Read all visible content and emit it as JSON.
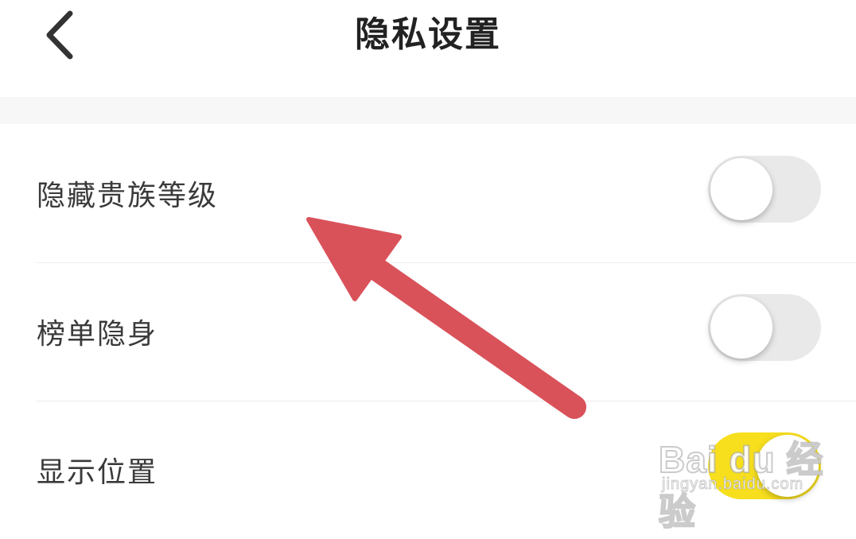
{
  "header": {
    "title": "隐私设置",
    "back_icon": "chevron-left-icon"
  },
  "settings": [
    {
      "label": "隐藏贵族等级",
      "enabled": false
    },
    {
      "label": "榜单隐身",
      "enabled": false
    },
    {
      "label": "显示位置",
      "enabled": true
    }
  ],
  "annotation": {
    "icon": "arrow-icon",
    "color": "#d9525a"
  },
  "watermark": {
    "logo": "Bai du 经验",
    "url": "jingyan.baidu.com"
  },
  "colors": {
    "toggle_on": "#f7df1e",
    "toggle_off": "#e9e9e9"
  }
}
